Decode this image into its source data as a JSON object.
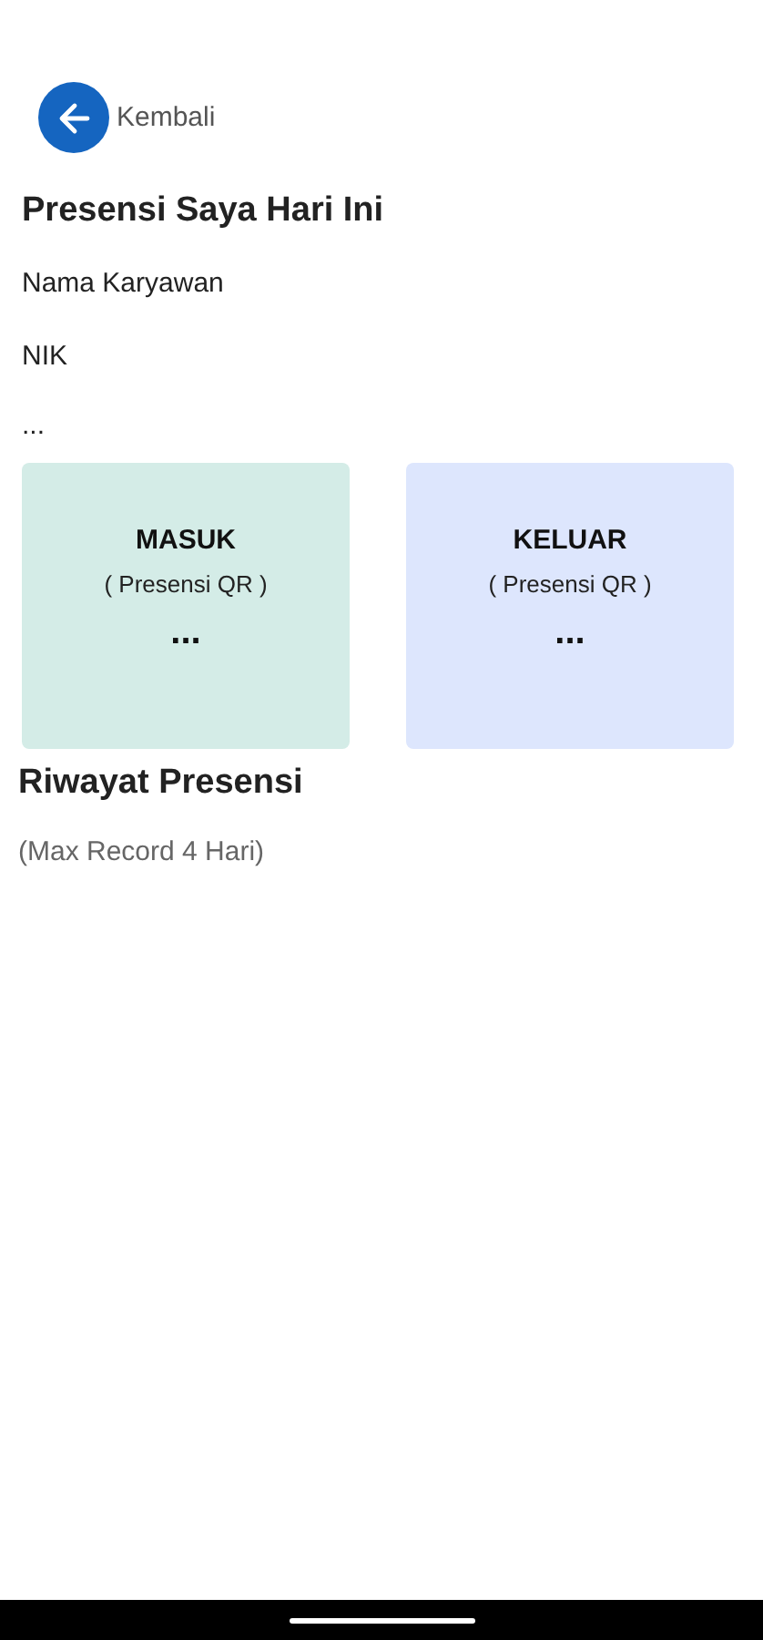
{
  "header": {
    "back_label": "Kembali"
  },
  "title": "Presensi Saya Hari Ini",
  "employee": {
    "name": "Nama Karyawan",
    "nik": "NIK",
    "status": "..."
  },
  "cards": [
    {
      "title": "MASUK",
      "subtitle": "( Presensi QR )",
      "time": "...",
      "color": "#d4ece7"
    },
    {
      "title": "KELUAR",
      "subtitle": "( Presensi QR )",
      "time": "...",
      "color": "#dde6fd"
    }
  ],
  "history": {
    "title": "Riwayat Presensi",
    "note": "(Max Record 4 Hari)"
  }
}
